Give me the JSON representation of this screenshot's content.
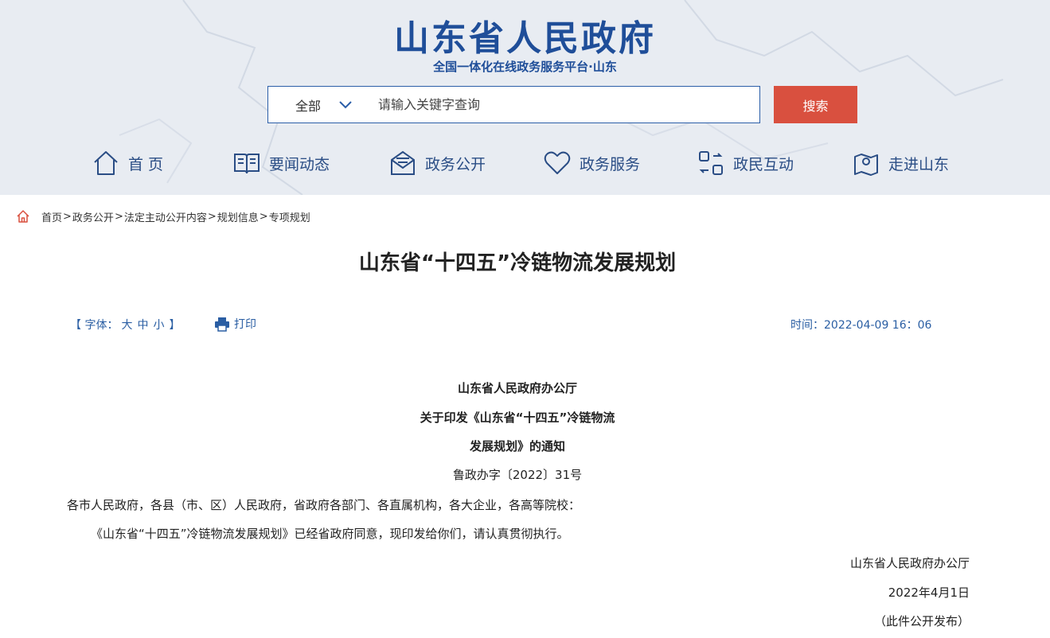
{
  "header": {
    "title": "山东省人民政府",
    "subtitle": "全国一体化在线政务服务平台·山东",
    "search": {
      "scope": "全部",
      "placeholder": "请输入关键字查询",
      "button": "搜索"
    },
    "nav": [
      {
        "label": "首 页",
        "icon": "home-icon"
      },
      {
        "label": "要闻动态",
        "icon": "book-icon"
      },
      {
        "label": "政务公开",
        "icon": "mail-icon"
      },
      {
        "label": "政务服务",
        "icon": "heart-icon"
      },
      {
        "label": "政民互动",
        "icon": "exchange-icon"
      },
      {
        "label": "走进山东",
        "icon": "map-pin-icon"
      }
    ],
    "colors": {
      "brand": "#1f4e99",
      "search_button": "#d9503f",
      "header_bg": "#e8ecf2"
    }
  },
  "breadcrumb": {
    "items": [
      "首页",
      "政务公开",
      "法定主动公开内容",
      "规划信息",
      "专项规划"
    ],
    "separator": ">"
  },
  "article": {
    "title": "山东省“十四五”冷链物流发展规划",
    "font_label_open": "【 字体：",
    "font_large": "大",
    "font_medium": "中",
    "font_small": "小",
    "font_label_close": "】",
    "print": "打印",
    "time": "时间：2022-04-09 16：06",
    "issuer": "山东省人民政府办公厅",
    "notice_title_line1": "关于印发《山东省“十四五”冷链物流",
    "notice_title_line2": "发展规划》的通知",
    "doc_number": "鲁政办字〔2022〕31号",
    "addressee": "各市人民政府，各县（市、区）人民政府，省政府各部门、各直属机构，各大企业，各高等院校：",
    "body": "《山东省“十四五”冷链物流发展规划》已经省政府同意，现印发给你们，请认真贯彻执行。",
    "signature": "山东省人民政府办公厅",
    "date": "2022年4月1日",
    "note": "（此件公开发布）"
  }
}
